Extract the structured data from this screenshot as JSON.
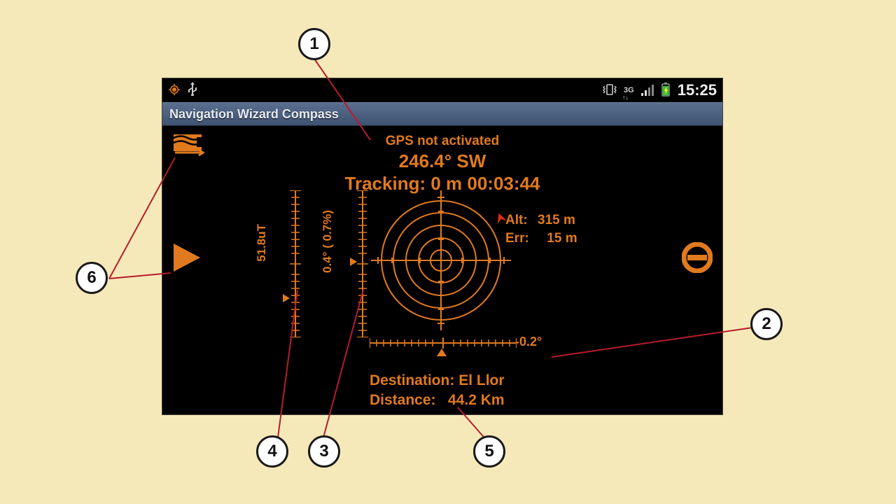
{
  "statusbar": {
    "time": "15:25",
    "icons": [
      "location",
      "usb",
      "vibrate",
      "3g",
      "signal",
      "battery-charging"
    ]
  },
  "titlebar": {
    "title": "Navigation Wizard Compass"
  },
  "top": {
    "gps": "GPS not activated",
    "heading": "246.4° SW",
    "tracking": "Tracking: 0 m 00:03:44"
  },
  "altitude": {
    "alt_label": "Alt:",
    "alt_value": "315 m",
    "err_label": "Err:",
    "err_value": "15 m"
  },
  "scales": {
    "field_strength": "51.8uT",
    "pitch": "0.4° (  0.7%)",
    "roll": "-0.2°"
  },
  "destination": {
    "dest_label": "Destination:",
    "dest_value": "El Llor",
    "dist_label": "Distance:",
    "dist_value": "44.2 Km"
  },
  "callouts": {
    "c1": "1",
    "c2": "2",
    "c3": "3",
    "c4": "4",
    "c5": "5",
    "c6": "6"
  }
}
